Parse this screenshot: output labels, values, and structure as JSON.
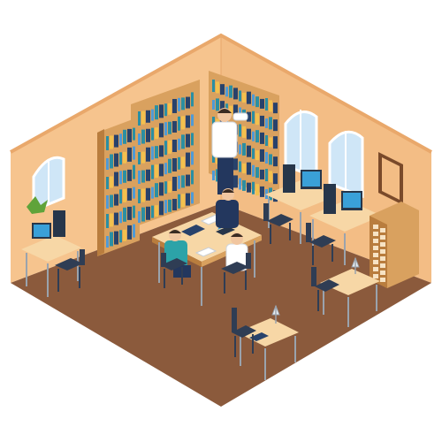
{
  "scene": {
    "subject": "isometric-library-study-room",
    "colors": {
      "wall_left": "#f6c48e",
      "wall_right": "#f3bd85",
      "wall_edge": "#e9a86b",
      "floor": "#8b5a3c",
      "shelf": "#d9a15f",
      "shelf_dark": "#b97d3e",
      "desk_top": "#f7d7a6",
      "desk_leg": "#9aa3ad",
      "chair": "#2f3d54",
      "monitor": "#27364a",
      "screen": "#3aa0d8",
      "window_sky": "#cfe6f7",
      "book_teal": "#2b8fa3",
      "book_yellow": "#f2c14e",
      "book_navy": "#28426b",
      "book_blue": "#4f9ad6",
      "person_shirt_white": "#ffffff",
      "person_shirt_navy": "#23375e",
      "person_shirt_teal": "#2ca3a8",
      "skin": "#f1c6a0",
      "hair": "#3b2b22",
      "plant": "#5fa33a",
      "frame": "#7a4a2a"
    }
  }
}
